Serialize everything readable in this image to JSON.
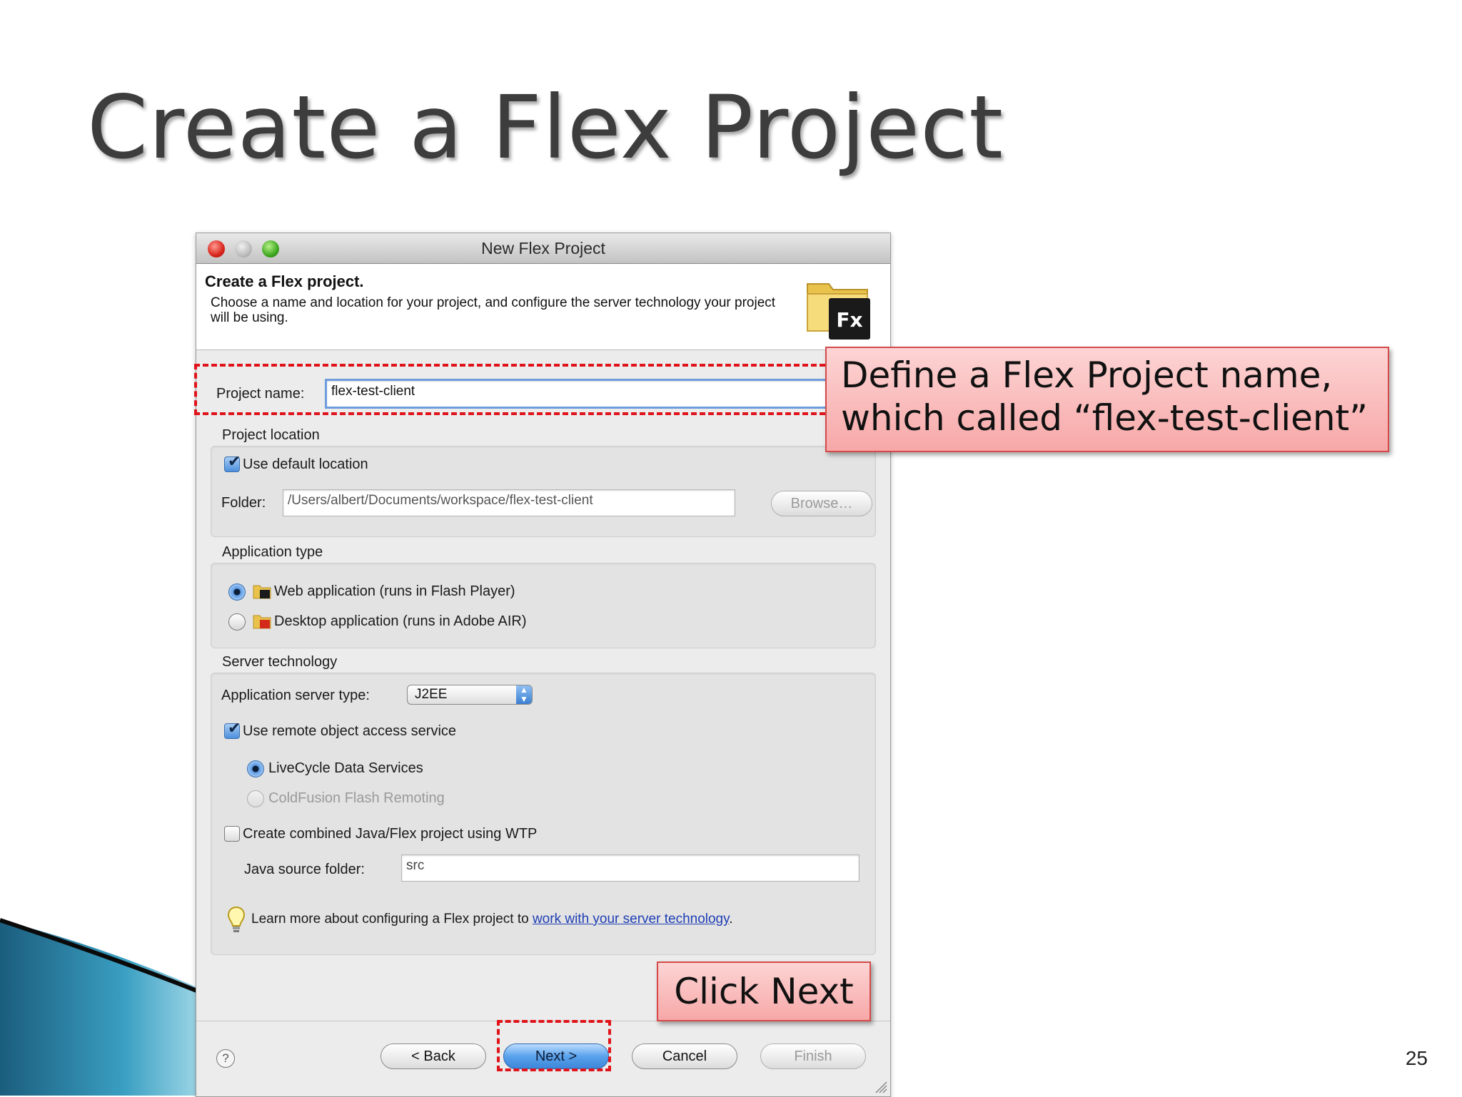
{
  "slide": {
    "title": "Create a Flex Project",
    "page_number": "25"
  },
  "dialog": {
    "window_title": "New Flex Project",
    "header_title": "Create a Flex project.",
    "header_description": "Choose a name and location for your project, and configure the server technology your project will be using.",
    "project_name_label": "Project name:",
    "project_name_value": "flex-test-client",
    "project_location_label": "Project location",
    "use_default_location_label": "Use default location",
    "use_default_location_checked": true,
    "folder_label": "Folder:",
    "folder_value": "/Users/albert/Documents/workspace/flex-test-client",
    "browse_label": "Browse…",
    "application_type_label": "Application type",
    "app_type_options": [
      "Web application (runs in Flash Player)",
      "Desktop application (runs in Adobe AIR)"
    ],
    "app_type_selected": "Web application (runs in Flash Player)",
    "server_technology_label": "Server technology",
    "app_server_type_label": "Application server type:",
    "app_server_type_value": "J2EE",
    "use_remote_object_label": "Use remote object access service",
    "use_remote_object_checked": true,
    "remote_options": [
      "LiveCycle Data Services",
      "ColdFusion Flash Remoting"
    ],
    "remote_selected": "LiveCycle Data Services",
    "combined_project_label": "Create combined Java/Flex project using WTP",
    "combined_project_checked": false,
    "java_source_folder_label": "Java source folder:",
    "java_source_folder_value": "src",
    "learn_more_prefix": "Learn more about configuring a Flex project to ",
    "learn_more_link": "work with your server technology",
    "learn_more_suffix": ".",
    "buttons": {
      "help": "?",
      "back": "< Back",
      "next": "Next >",
      "cancel": "Cancel",
      "finish": "Finish"
    },
    "fx_logo_text": "Fx"
  },
  "callouts": {
    "project_name_line1": "Define a Flex Project name,",
    "project_name_line2": "which called “flex-test-client”",
    "next": "Click Next"
  },
  "colors": {
    "callout_fill": "#f7a8a8",
    "dash_red": "#e0131a",
    "link_blue": "#1f3fb4"
  }
}
